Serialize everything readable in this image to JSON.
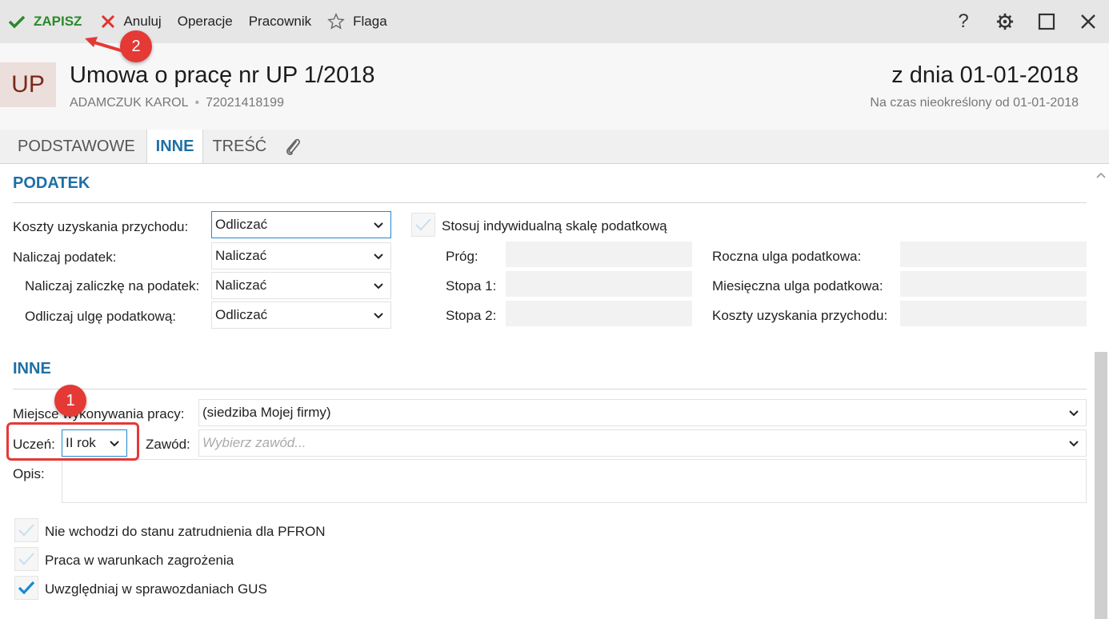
{
  "toolbar": {
    "save": "ZAPISZ",
    "cancel": "Anuluj",
    "operations": "Operacje",
    "employee": "Pracownik",
    "flag": "Flaga",
    "help": "?"
  },
  "header": {
    "badge": "UP",
    "title": "Umowa o pracę nr UP 1/2018",
    "employee_name": "ADAMCZUK KAROL",
    "employee_id": "72021418199",
    "date": "z dnia 01-01-2018",
    "term": "Na czas nieokreślony od 01-01-2018"
  },
  "tabs": [
    "PODSTAWOWE",
    "INNE",
    "TREŚĆ"
  ],
  "tax": {
    "title": "PODATEK",
    "rows": [
      {
        "label": "Koszty uzyskania przychodu:",
        "value": "Odliczać"
      },
      {
        "label": "Naliczaj podatek:",
        "value": "Naliczać"
      },
      {
        "label": "Naliczaj zaliczkę na podatek:",
        "value": "Naliczać"
      },
      {
        "label": "Odliczaj ulgę podatkową:",
        "value": "Odliczać"
      }
    ],
    "individual_scale": "Stosuj indywidualną skalę podatkową",
    "prog": "Próg:",
    "stopa1": "Stopa 1:",
    "stopa2": "Stopa 2:",
    "annual_relief": "Roczna ulga podatkowa:",
    "monthly_relief": "Miesięczna ulga podatkowa:",
    "costs": "Koszty uzyskania przychodu:"
  },
  "other": {
    "title": "INNE",
    "workplace_label": "Miejsce wykonywania pracy:",
    "workplace_value": "(siedziba Mojej firmy)",
    "student_label": "Uczeń:",
    "student_value": "II rok",
    "profession_label": "Zawód:",
    "profession_placeholder": "Wybierz zawód...",
    "description_label": "Opis:",
    "checkboxes": [
      {
        "label": "Nie wchodzi do stanu zatrudnienia dla PFRON",
        "checked": false
      },
      {
        "label": "Praca w warunkach zagrożenia",
        "checked": false
      },
      {
        "label": "Uwzględniaj w sprawozdaniach GUS",
        "checked": true
      }
    ]
  },
  "annotations": {
    "one": "1",
    "two": "2"
  },
  "colors": {
    "accent": "#1f6fa5",
    "save": "#2a8a2a",
    "annotation": "#e53935"
  }
}
